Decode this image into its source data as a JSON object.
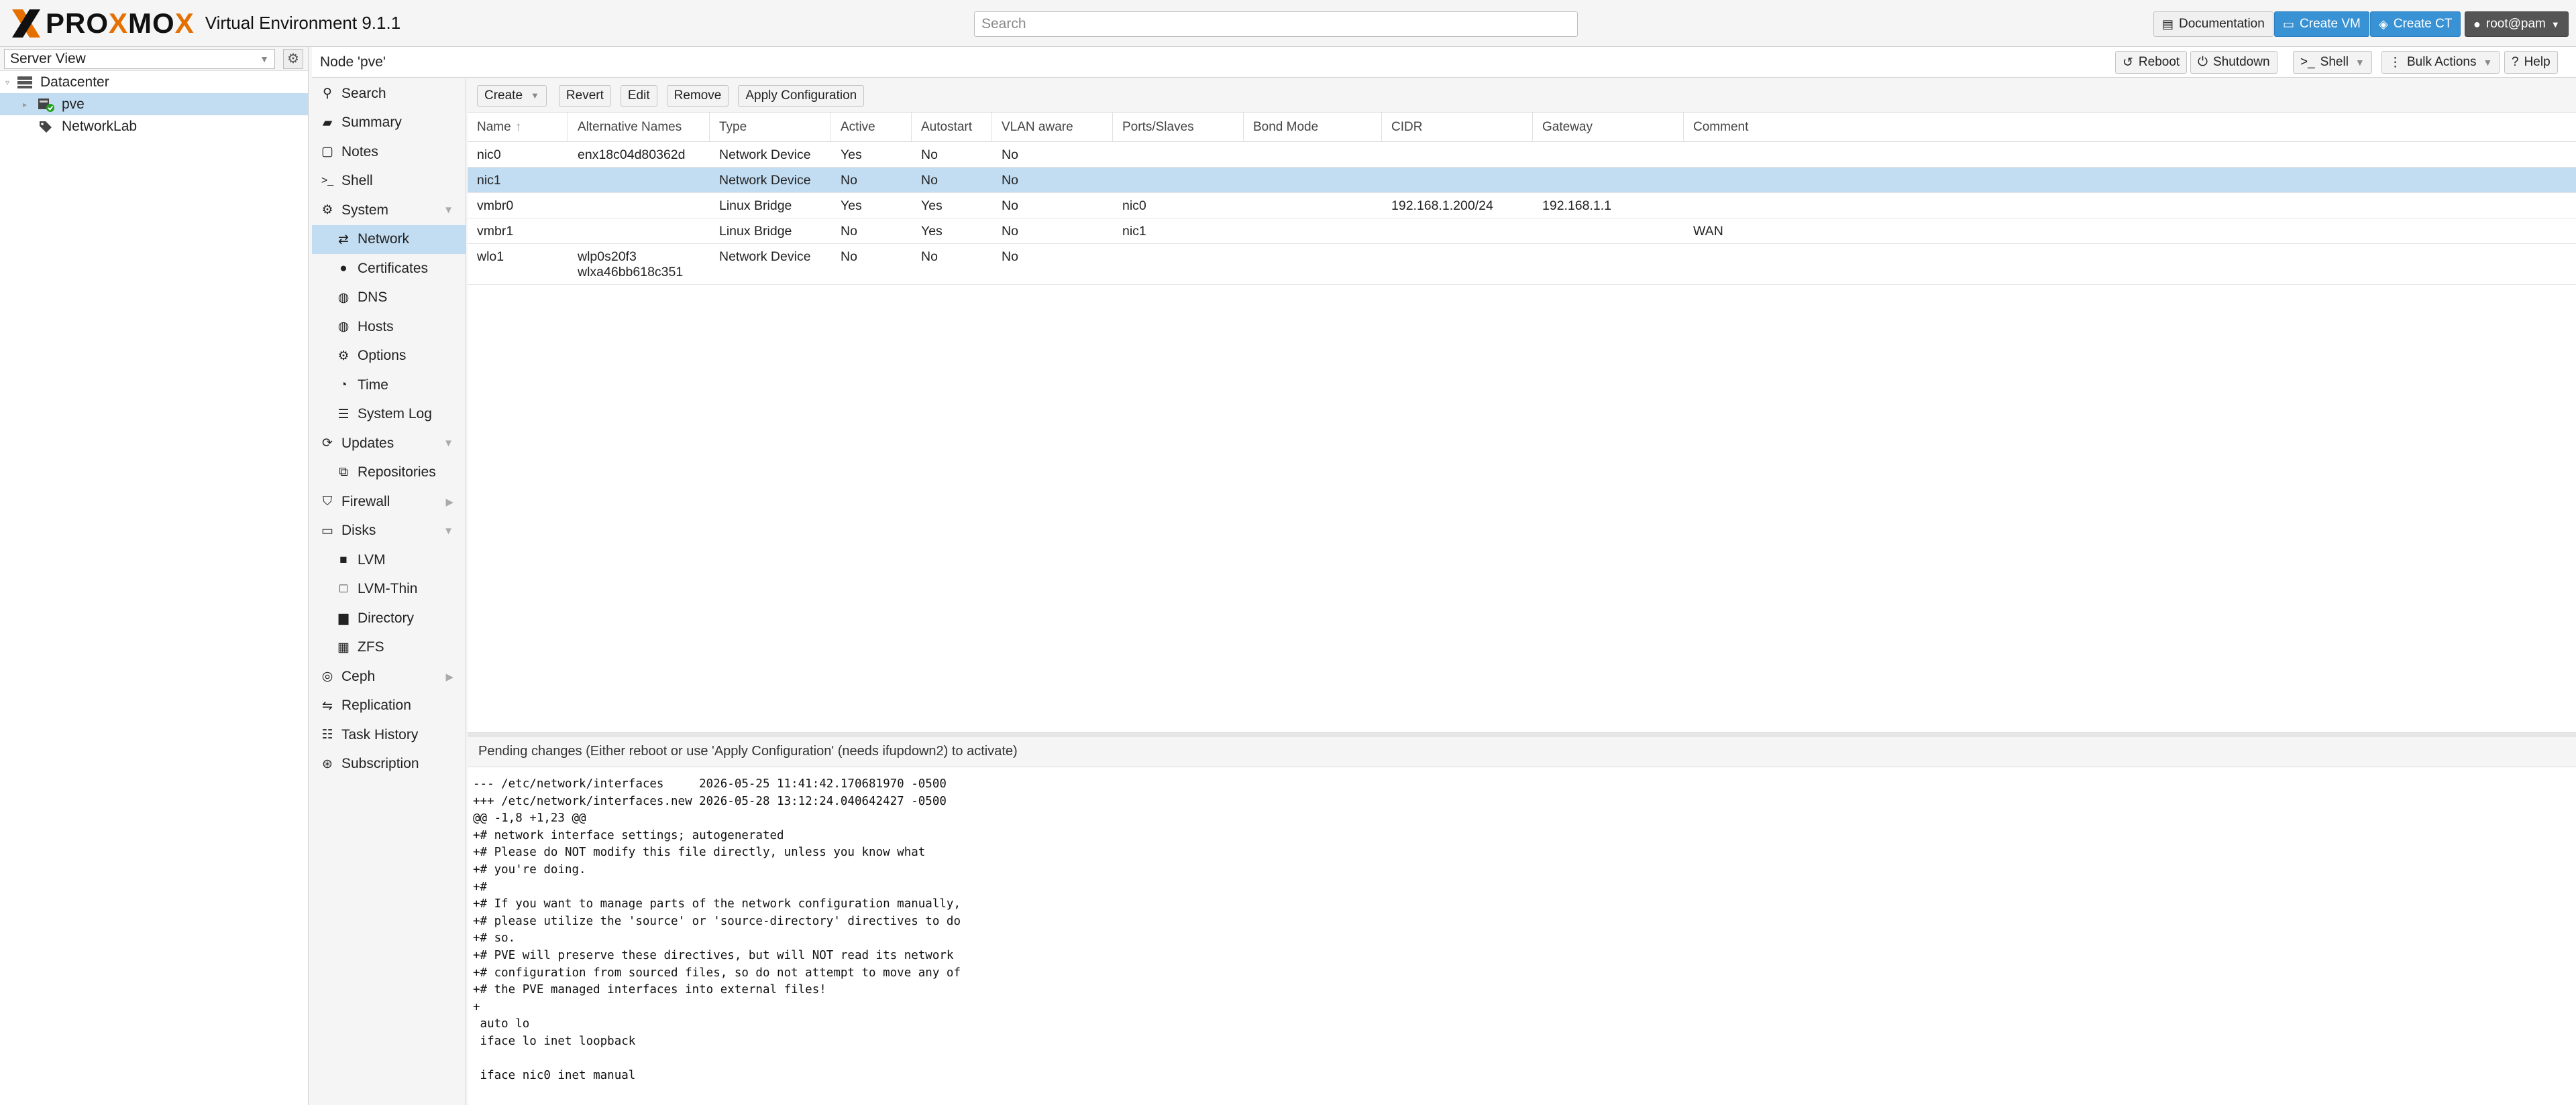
{
  "header": {
    "logo_text_1": "PRO",
    "logo_text_2": "X",
    "logo_text_3": "MO",
    "logo_text_4": "X",
    "version": "Virtual Environment 9.1.1",
    "search_placeholder": "Search",
    "documentation": "Documentation",
    "create_vm": "Create VM",
    "create_ct": "Create CT",
    "user": "root@pam"
  },
  "tree": {
    "view": "Server View",
    "items": [
      {
        "label": "Datacenter",
        "icon": "server-stack-icon"
      },
      {
        "label": "pve",
        "icon": "node-online-icon",
        "selected": true
      },
      {
        "label": "NetworkLab",
        "icon": "tags-icon"
      }
    ]
  },
  "content": {
    "title": "Node 'pve'",
    "reboot": "Reboot",
    "shutdown": "Shutdown",
    "shell": "Shell",
    "bulk_actions": "Bulk Actions",
    "help": "Help"
  },
  "nav": {
    "items": [
      {
        "label": "Search",
        "icon": "search-icon"
      },
      {
        "label": "Summary",
        "icon": "book-icon"
      },
      {
        "label": "Notes",
        "icon": "notes-icon"
      },
      {
        "label": "Shell",
        "icon": "terminal-icon"
      },
      {
        "label": "System",
        "icon": "cogs-icon"
      },
      {
        "label": "Network",
        "icon": "exchange-icon"
      },
      {
        "label": "Certificates",
        "icon": "certificate-icon"
      },
      {
        "label": "DNS",
        "icon": "globe-icon"
      },
      {
        "label": "Hosts",
        "icon": "globe-icon"
      },
      {
        "label": "Options",
        "icon": "gear-icon"
      },
      {
        "label": "Time",
        "icon": "clock-icon"
      },
      {
        "label": "System Log",
        "icon": "list-icon"
      },
      {
        "label": "Updates",
        "icon": "refresh-icon"
      },
      {
        "label": "Repositories",
        "icon": "repositories-icon"
      },
      {
        "label": "Firewall",
        "icon": "shield-icon"
      },
      {
        "label": "Disks",
        "icon": "hdd-icon"
      },
      {
        "label": "LVM",
        "icon": "square-icon"
      },
      {
        "label": "LVM-Thin",
        "icon": "square-outline-icon"
      },
      {
        "label": "Directory",
        "icon": "folder-icon"
      },
      {
        "label": "ZFS",
        "icon": "th-large-icon"
      },
      {
        "label": "Ceph",
        "icon": "ceph-icon"
      },
      {
        "label": "Replication",
        "icon": "retweet-icon"
      },
      {
        "label": "Task History",
        "icon": "list-alt-icon"
      },
      {
        "label": "Subscription",
        "icon": "support-icon"
      }
    ]
  },
  "toolbar": {
    "create": "Create",
    "revert": "Revert",
    "edit": "Edit",
    "remove": "Remove",
    "apply": "Apply Configuration"
  },
  "grid": {
    "columns": [
      "Name",
      "Alternative Names",
      "Type",
      "Active",
      "Autostart",
      "VLAN aware",
      "Ports/Slaves",
      "Bond Mode",
      "CIDR",
      "Gateway",
      "Comment"
    ],
    "sort_indicator": "↑",
    "rows": [
      [
        "nic0",
        "enx18c04d80362d",
        "Network Device",
        "Yes",
        "No",
        "No",
        "",
        "",
        "",
        "",
        ""
      ],
      [
        "nic1",
        "",
        "Network Device",
        "No",
        "No",
        "No",
        "",
        "",
        "",
        "",
        ""
      ],
      [
        "vmbr0",
        "",
        "Linux Bridge",
        "Yes",
        "Yes",
        "No",
        "nic0",
        "",
        "192.168.1.200/24",
        "192.168.1.1",
        ""
      ],
      [
        "vmbr1",
        "",
        "Linux Bridge",
        "No",
        "Yes",
        "No",
        "nic1",
        "",
        "",
        "",
        "WAN"
      ],
      [
        "wlo1",
        "wlp0s20f3\nwlxa46bb618c351",
        "Network Device",
        "No",
        "No",
        "No",
        "",
        "",
        "",
        "",
        ""
      ]
    ]
  },
  "pending": {
    "title": "Pending changes (Either reboot or use 'Apply Configuration' (needs ifupdown2) to activate)",
    "diff": "--- /etc/network/interfaces     2026-05-25 11:41:42.170681970 -0500\n+++ /etc/network/interfaces.new 2026-05-28 13:12:24.040642427 -0500\n@@ -1,8 +1,23 @@\n+# network interface settings; autogenerated\n+# Please do NOT modify this file directly, unless you know what\n+# you're doing.\n+#\n+# If you want to manage parts of the network configuration manually,\n+# please utilize the 'source' or 'source-directory' directives to do\n+# so.\n+# PVE will preserve these directives, but will NOT read its network\n+# configuration from sourced files, so do not attempt to move any of\n+# the PVE managed interfaces into external files!\n+\n auto lo\n iface lo inet loopback\n\n iface nic0 inet manual"
  },
  "colors": {
    "accent": "#e57000",
    "selection": "#c2ddf2",
    "button_blue": "#3892d4"
  }
}
